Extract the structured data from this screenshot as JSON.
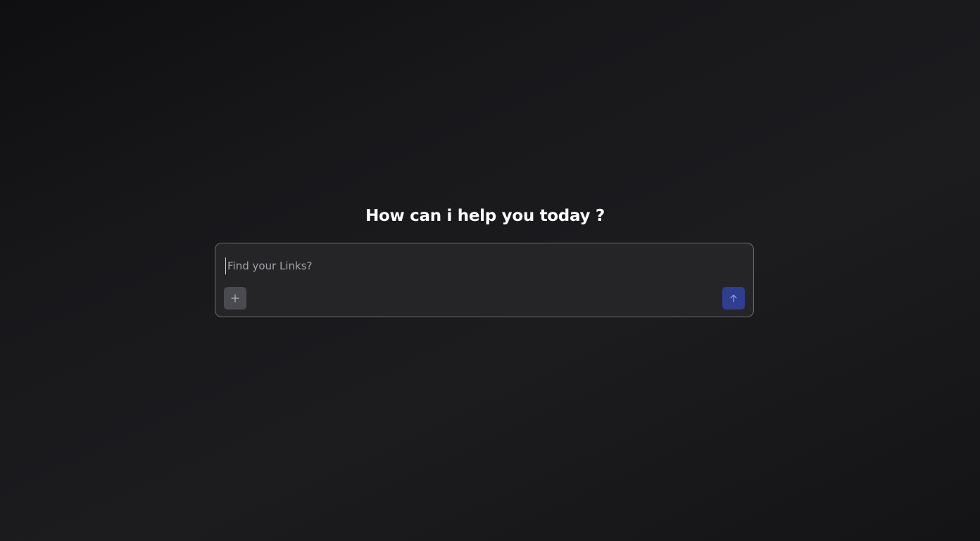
{
  "main": {
    "heading": "How can i help you today ?"
  },
  "composer": {
    "placeholder": "Find your Links?",
    "value": "",
    "attach_icon": "plus-icon",
    "send_icon": "arrow-up-icon"
  },
  "colors": {
    "background": "#18181b",
    "composer_bg": "#252528",
    "composer_border": "#6e6e74",
    "attach_button": "#4a4a51",
    "send_button": "#2f3e8f",
    "heading_text": "#ffffff",
    "placeholder_text": "#a1a1aa"
  }
}
